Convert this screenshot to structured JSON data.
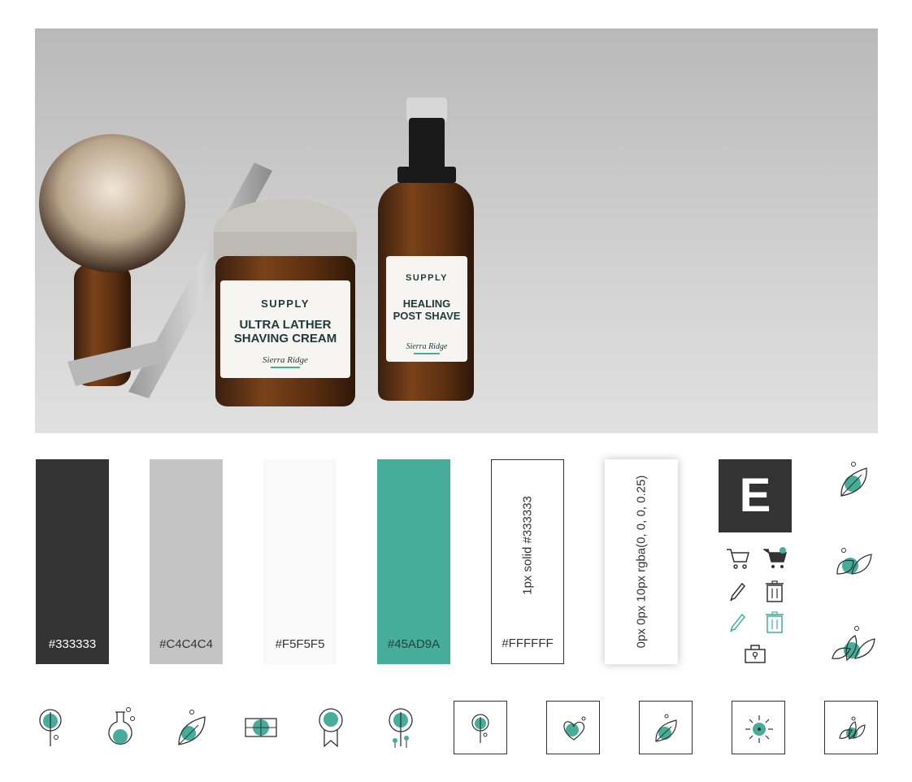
{
  "palette": {
    "dark": "#333333",
    "gray": "#C4C4C4",
    "light": "#F5F5F5",
    "accent": "#45AD9A",
    "white": "#FFFFFF"
  },
  "swatches": {
    "dark_label": "#333333",
    "gray_label": "#C4C4C4",
    "light_label": "#F5F5F5",
    "accent_label": "#45AD9A",
    "white_label": "#FFFFFF",
    "border_label": "1px solid #333333",
    "shadow_label": "0px 0px 10px rgba(0, 0, 0, 0.25)"
  },
  "logo": {
    "letter": "E"
  },
  "product_labels": {
    "brand": "SUPPLY",
    "jar_line1": "ULTRA LATHER",
    "jar_line2": "SHAVING CREAM",
    "bottle_line1": "HEALING",
    "bottle_line2": "POST SHAVE",
    "signature": "Sierra Ridge"
  },
  "icons": {
    "ui": [
      "cart-icon",
      "cart-badge-icon",
      "pencil-icon",
      "trash-icon",
      "pencil-accent-icon",
      "trash-accent-icon",
      "lock-icon"
    ],
    "leaf_column": [
      "leaf-single-icon",
      "leaf-double-icon",
      "leaf-triple-icon"
    ],
    "bottom_row": [
      "flower-icon",
      "flask-icon",
      "leaf-icon",
      "frame-icon",
      "badge-icon",
      "plant-icon"
    ],
    "boxed_row": [
      "boxed-flower-icon",
      "boxed-heart-icon",
      "boxed-leaf-icon",
      "boxed-sun-icon",
      "boxed-leaves-icon"
    ]
  }
}
